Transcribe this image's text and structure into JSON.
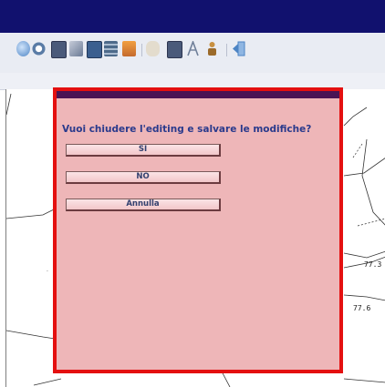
{
  "toolbar": {
    "icons": [
      {
        "name": "info-icon",
        "color": "#4f86c6"
      },
      {
        "name": "circle-icon",
        "color": "#5a7ca6"
      },
      {
        "name": "edit-layer-icon",
        "color": "#4a5a7a"
      },
      {
        "name": "layer-select-icon",
        "color": "#6a7a95"
      },
      {
        "name": "edit-feature-icon",
        "color": "#3b5f8f"
      },
      {
        "name": "table-icon",
        "color": "#4d6a8a"
      },
      {
        "name": "move-icon",
        "color": "#c46a2d"
      },
      {
        "name": "hand-icon",
        "color": "#c9b99a"
      },
      {
        "name": "pencil-icon",
        "color": "#4a5a7a"
      },
      {
        "name": "measure-icon",
        "color": "#7f8fa8"
      },
      {
        "name": "user-icon",
        "color": "#c89040"
      },
      {
        "name": "exit-icon",
        "color": "#4c84c4"
      }
    ]
  },
  "dialog": {
    "question": "Vuoi chiudere l'editing e salvare le modifiche?",
    "yes_label": "SI",
    "no_label": "NO",
    "cancel_label": "Annulla"
  },
  "map": {
    "labels": [
      "77.3",
      "77.6"
    ]
  },
  "colors": {
    "title_bar": "#11116e",
    "dialog_border": "#e41010",
    "dialog_background": "#f3bdbd",
    "dialog_title_bar": "#4a1454",
    "question_text": "#2a3a8c"
  }
}
